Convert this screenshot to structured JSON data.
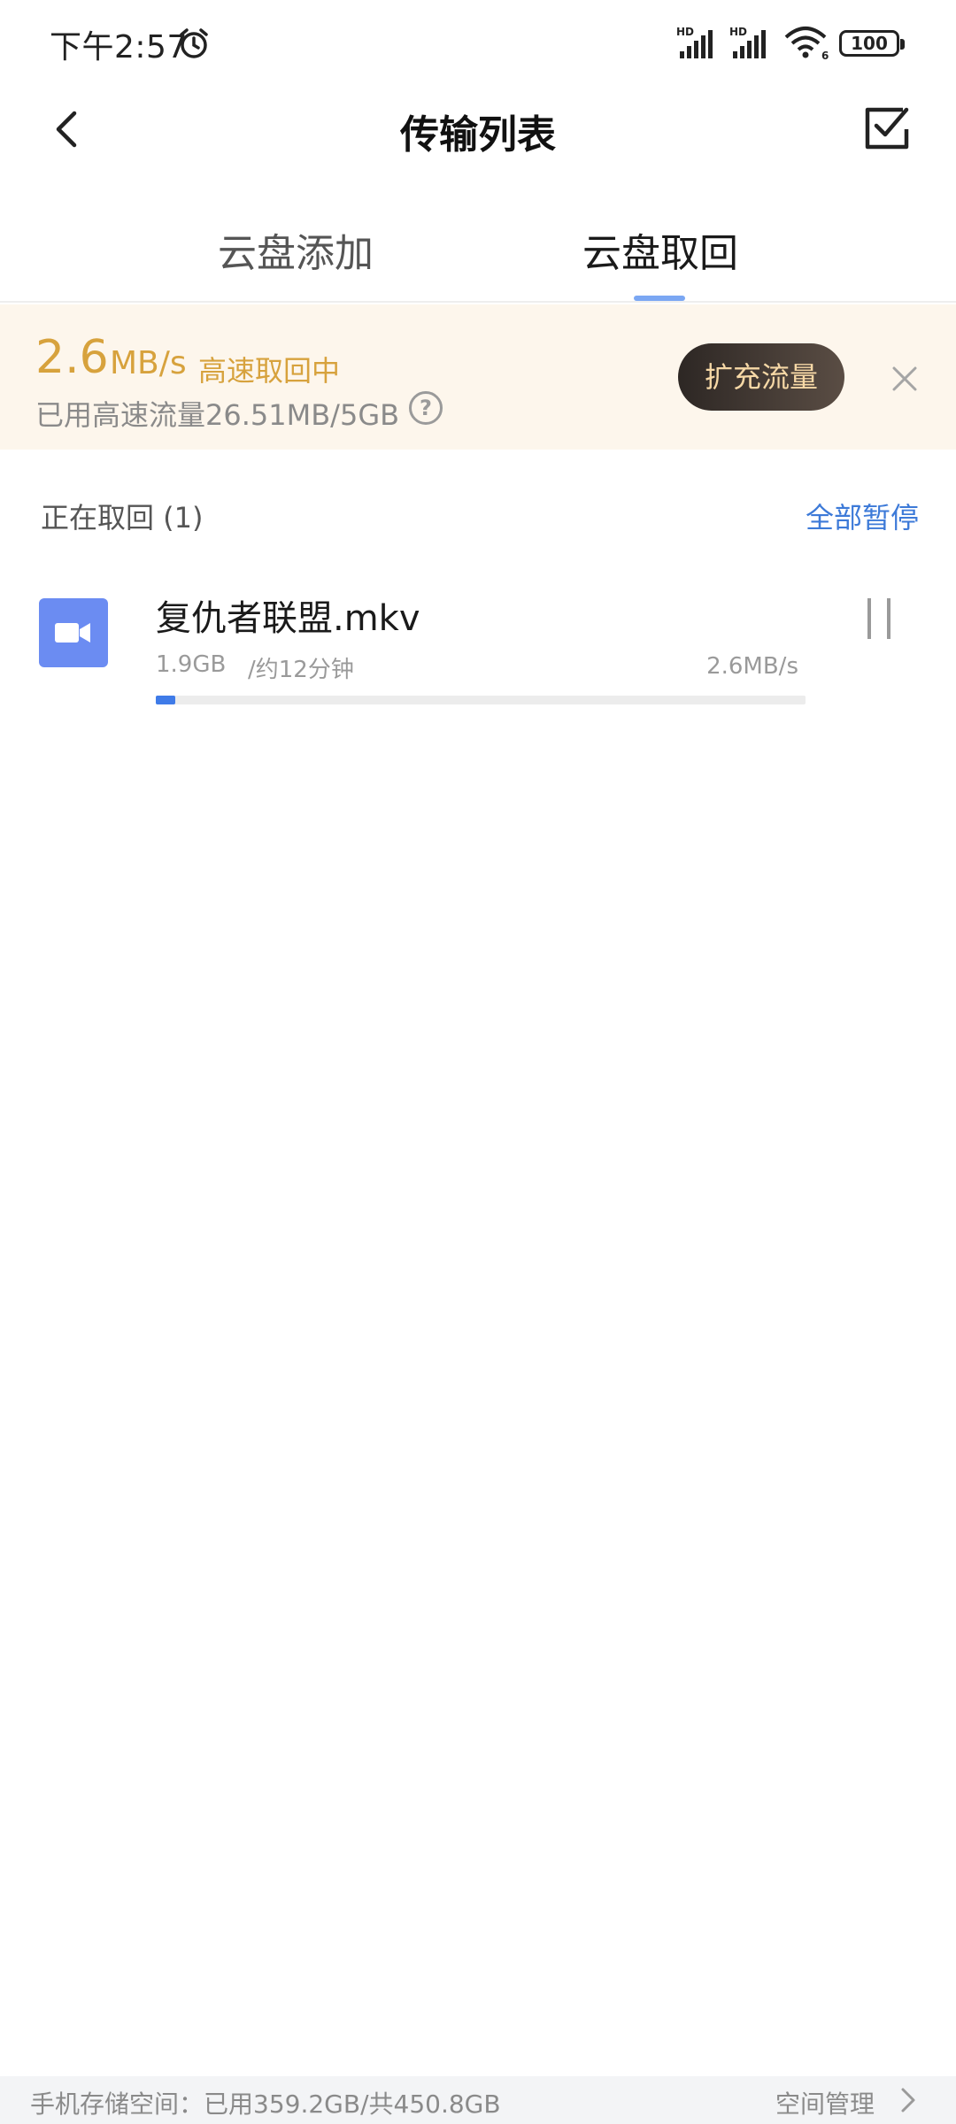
{
  "status_bar": {
    "time": "下午2:57",
    "battery": "100",
    "signal_labels": [
      "HD",
      "HD"
    ],
    "wifi_badge": "6"
  },
  "nav": {
    "title": "传输列表",
    "back_icon": "chevron-left-icon",
    "select_icon": "checkbox-select-icon"
  },
  "tabs": [
    {
      "label": "云盘添加",
      "active": false
    },
    {
      "label": "云盘取回",
      "active": true
    }
  ],
  "banner": {
    "speed_value": "2.6",
    "speed_unit": "MB/s",
    "speed_status": "高速取回中",
    "usage_text": "已用高速流量26.51MB/5GB",
    "help_icon": "question-circle-icon",
    "expand_button": "扩充流量",
    "close_icon": "close-icon",
    "accent_color": "#d7a23d"
  },
  "section": {
    "title": "正在取回 (1)",
    "pause_all": "全部暂停"
  },
  "files": [
    {
      "name": "复仇者联盟.mkv",
      "size": "1.9GB",
      "eta": "/约12分钟",
      "rate": "2.6MB/s",
      "progress": 0.03,
      "icon": "video-file-icon",
      "pause_icon": "pause-icon"
    }
  ],
  "footer": {
    "storage_text": "手机存储空间：已用359.2GB/共450.8GB",
    "manage_label": "空间管理"
  },
  "colors": {
    "link_blue": "#3d7ad8",
    "progress_blue": "#3f7be8",
    "file_icon_bg": "#6b8cf2",
    "banner_bg": "#fdf6ec"
  }
}
